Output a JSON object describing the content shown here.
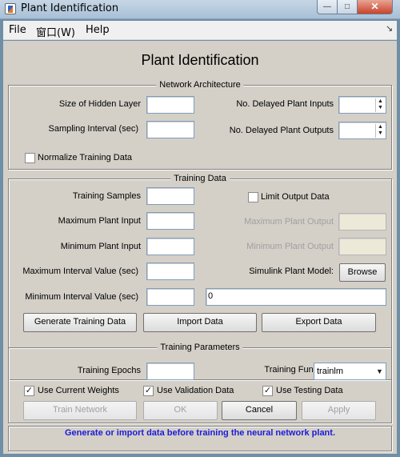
{
  "window": {
    "title": "Plant Identification",
    "min_glyph": "—",
    "max_glyph": "□",
    "close_glyph": "✕"
  },
  "menu": {
    "items": [
      "File",
      "窗口(W)",
      "Help"
    ],
    "dock_glyph": "↘"
  },
  "main_title": "Plant Identification",
  "network_architecture": {
    "title": "Network Architecture",
    "hidden_layer_label": "Size of Hidden Layer",
    "hidden_layer_value": "",
    "sampling_label": "Sampling Interval (sec)",
    "sampling_value": "",
    "normalize_label": "Normalize Training Data",
    "normalize_checked": false,
    "delayed_inputs_label": "No. Delayed Plant Inputs",
    "delayed_inputs_value": "",
    "delayed_outputs_label": "No. Delayed Plant Outputs",
    "delayed_outputs_value": ""
  },
  "training_data": {
    "title": "Training Data",
    "samples_label": "Training Samples",
    "samples_value": "",
    "max_input_label": "Maximum Plant Input",
    "max_input_value": "",
    "min_input_label": "Minimum Plant Input",
    "min_input_value": "",
    "max_interval_label": "Maximum Interval Value (sec)",
    "max_interval_value": "",
    "min_interval_label": "Minimum Interval Value (sec)",
    "min_interval_value": "",
    "limit_output_label": "Limit Output Data",
    "limit_output_checked": false,
    "max_output_label": "Maximum Plant Output",
    "max_output_value": "",
    "min_output_label": "Minimum Plant Output",
    "min_output_value": "",
    "simulink_label": "Simulink Plant Model:",
    "browse_label": "Browse",
    "model_value": "0",
    "generate_label": "Generate Training Data",
    "import_label": "Import Data",
    "export_label": "Export Data"
  },
  "training_parameters": {
    "title": "Training Parameters",
    "epochs_label": "Training Epochs",
    "epochs_value": "",
    "function_label": "Training Function",
    "function_value": "trainlm",
    "use_current_weights_label": "Use Current Weights",
    "use_current_weights_checked": true,
    "use_validation_label": "Use Validation Data",
    "use_validation_checked": true,
    "use_testing_label": "Use Testing Data",
    "use_testing_checked": true
  },
  "actions": {
    "train_label": "Train Network",
    "ok_label": "OK",
    "cancel_label": "Cancel",
    "apply_label": "Apply"
  },
  "status": {
    "message": "Generate or import data before training the neural network plant.",
    "color": "#1b1bd9"
  },
  "glyphs": {
    "check": "✓",
    "spin_up": "▲",
    "spin_down": "▼",
    "dropdown": "▼"
  }
}
